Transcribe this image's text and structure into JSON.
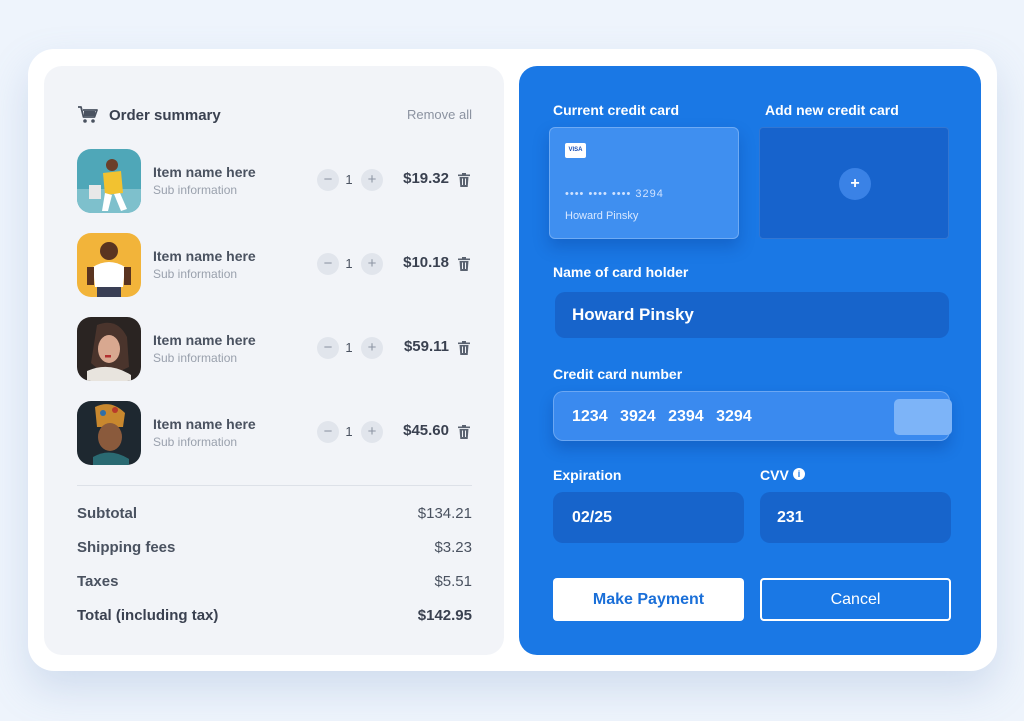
{
  "order_summary": {
    "title": "Order summary",
    "remove_all": "Remove all",
    "items": [
      {
        "name": "Item name here",
        "sub": "Sub information",
        "qty": "1",
        "price": "$19.32"
      },
      {
        "name": "Item name here",
        "sub": "Sub information",
        "qty": "1",
        "price": "$10.18"
      },
      {
        "name": "Item name here",
        "sub": "Sub information",
        "qty": "1",
        "price": "$59.11"
      },
      {
        "name": "Item name here",
        "sub": "Sub information",
        "qty": "1",
        "price": "$45.60"
      }
    ],
    "minus_symbol": "−",
    "plus_symbol": "+",
    "subtotal_label": "Subtotal",
    "subtotal_value": "$134.21",
    "shipping_label": "Shipping fees",
    "shipping_value": "$3.23",
    "taxes_label": "Taxes",
    "taxes_value": "$5.51",
    "total_label": "Total (including tax)",
    "total_value": "$142.95"
  },
  "payment": {
    "current_card_label": "Current credit card",
    "add_card_label": "Add new credit card",
    "card_brand": "VISA",
    "card_masked": "•••• •••• •••• 3294",
    "card_holder_on_card": "Howard Pinsky",
    "add_symbol": "+",
    "holder_label": "Name of card holder",
    "holder_value": "Howard Pinsky",
    "number_label": "Credit card number",
    "number_value": "1234 3924 2394 3294",
    "expiration_label": "Expiration",
    "expiration_value": "02/25",
    "cvv_label": "CVV",
    "cvv_info_symbol": "i",
    "cvv_value": "231",
    "pay_button": "Make Payment",
    "cancel_button": "Cancel"
  },
  "colors": {
    "background": "#eef4fc",
    "left_panel": "#f2f4f8",
    "right_panel": "#1a78e5",
    "field_dark": "#1764cb",
    "text_dark": "#3a4150"
  },
  "icons": [
    "cart-icon",
    "trash-icon",
    "minus-icon",
    "plus-icon",
    "visa-logo",
    "info-icon"
  ]
}
